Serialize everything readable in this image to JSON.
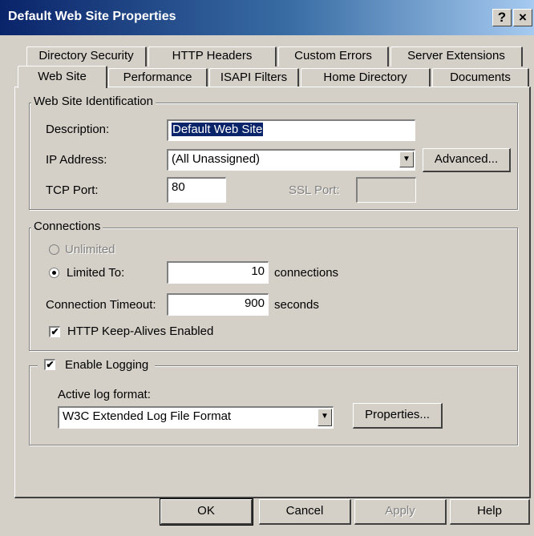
{
  "window": {
    "title": "Default Web Site Properties",
    "help_glyph": "?",
    "close_glyph": "×"
  },
  "tabs": {
    "row1": [
      "Directory Security",
      "HTTP Headers",
      "Custom Errors",
      "Server Extensions"
    ],
    "row2": [
      "Web Site",
      "Performance",
      "ISAPI Filters",
      "Home Directory",
      "Documents"
    ],
    "active": "Web Site"
  },
  "identification": {
    "legend": "Web Site Identification",
    "description_label": "Description:",
    "description_value": "Default Web Site",
    "ip_label": "IP Address:",
    "ip_value": "(All Unassigned)",
    "advanced_button": "Advanced...",
    "tcp_label": "TCP Port:",
    "tcp_value": "80",
    "ssl_label": "SSL Port:",
    "ssl_value": ""
  },
  "connections": {
    "legend": "Connections",
    "unlimited_label": "Unlimited",
    "limited_label": "Limited To:",
    "limited_value": "10",
    "limited_unit": "connections",
    "timeout_label": "Connection Timeout:",
    "timeout_value": "900",
    "timeout_unit": "seconds",
    "keepalive_label": "HTTP Keep-Alives Enabled",
    "keepalive_checked": true
  },
  "logging": {
    "enable_label": "Enable Logging",
    "enable_checked": true,
    "format_label": "Active log format:",
    "format_value": "W3C Extended Log File Format",
    "properties_button": "Properties..."
  },
  "footer": {
    "ok": "OK",
    "cancel": "Cancel",
    "apply": "Apply",
    "help": "Help"
  },
  "glyphs": {
    "check": "✔",
    "combo_arrow": "▼"
  }
}
